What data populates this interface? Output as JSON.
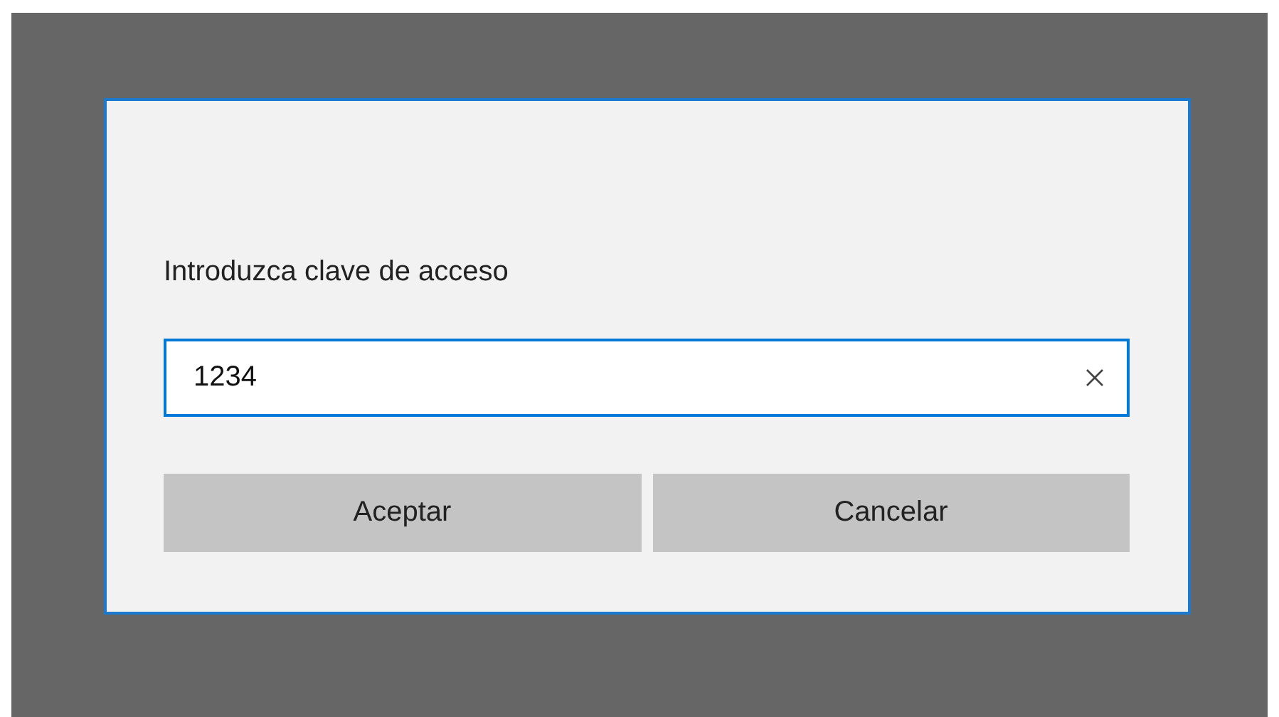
{
  "dialog": {
    "prompt": "Introduzca clave de acceso",
    "field": {
      "value": "1234",
      "focused": true
    },
    "buttons": [
      {
        "label": "Aceptar"
      },
      {
        "label": "Cancelar"
      }
    ]
  }
}
